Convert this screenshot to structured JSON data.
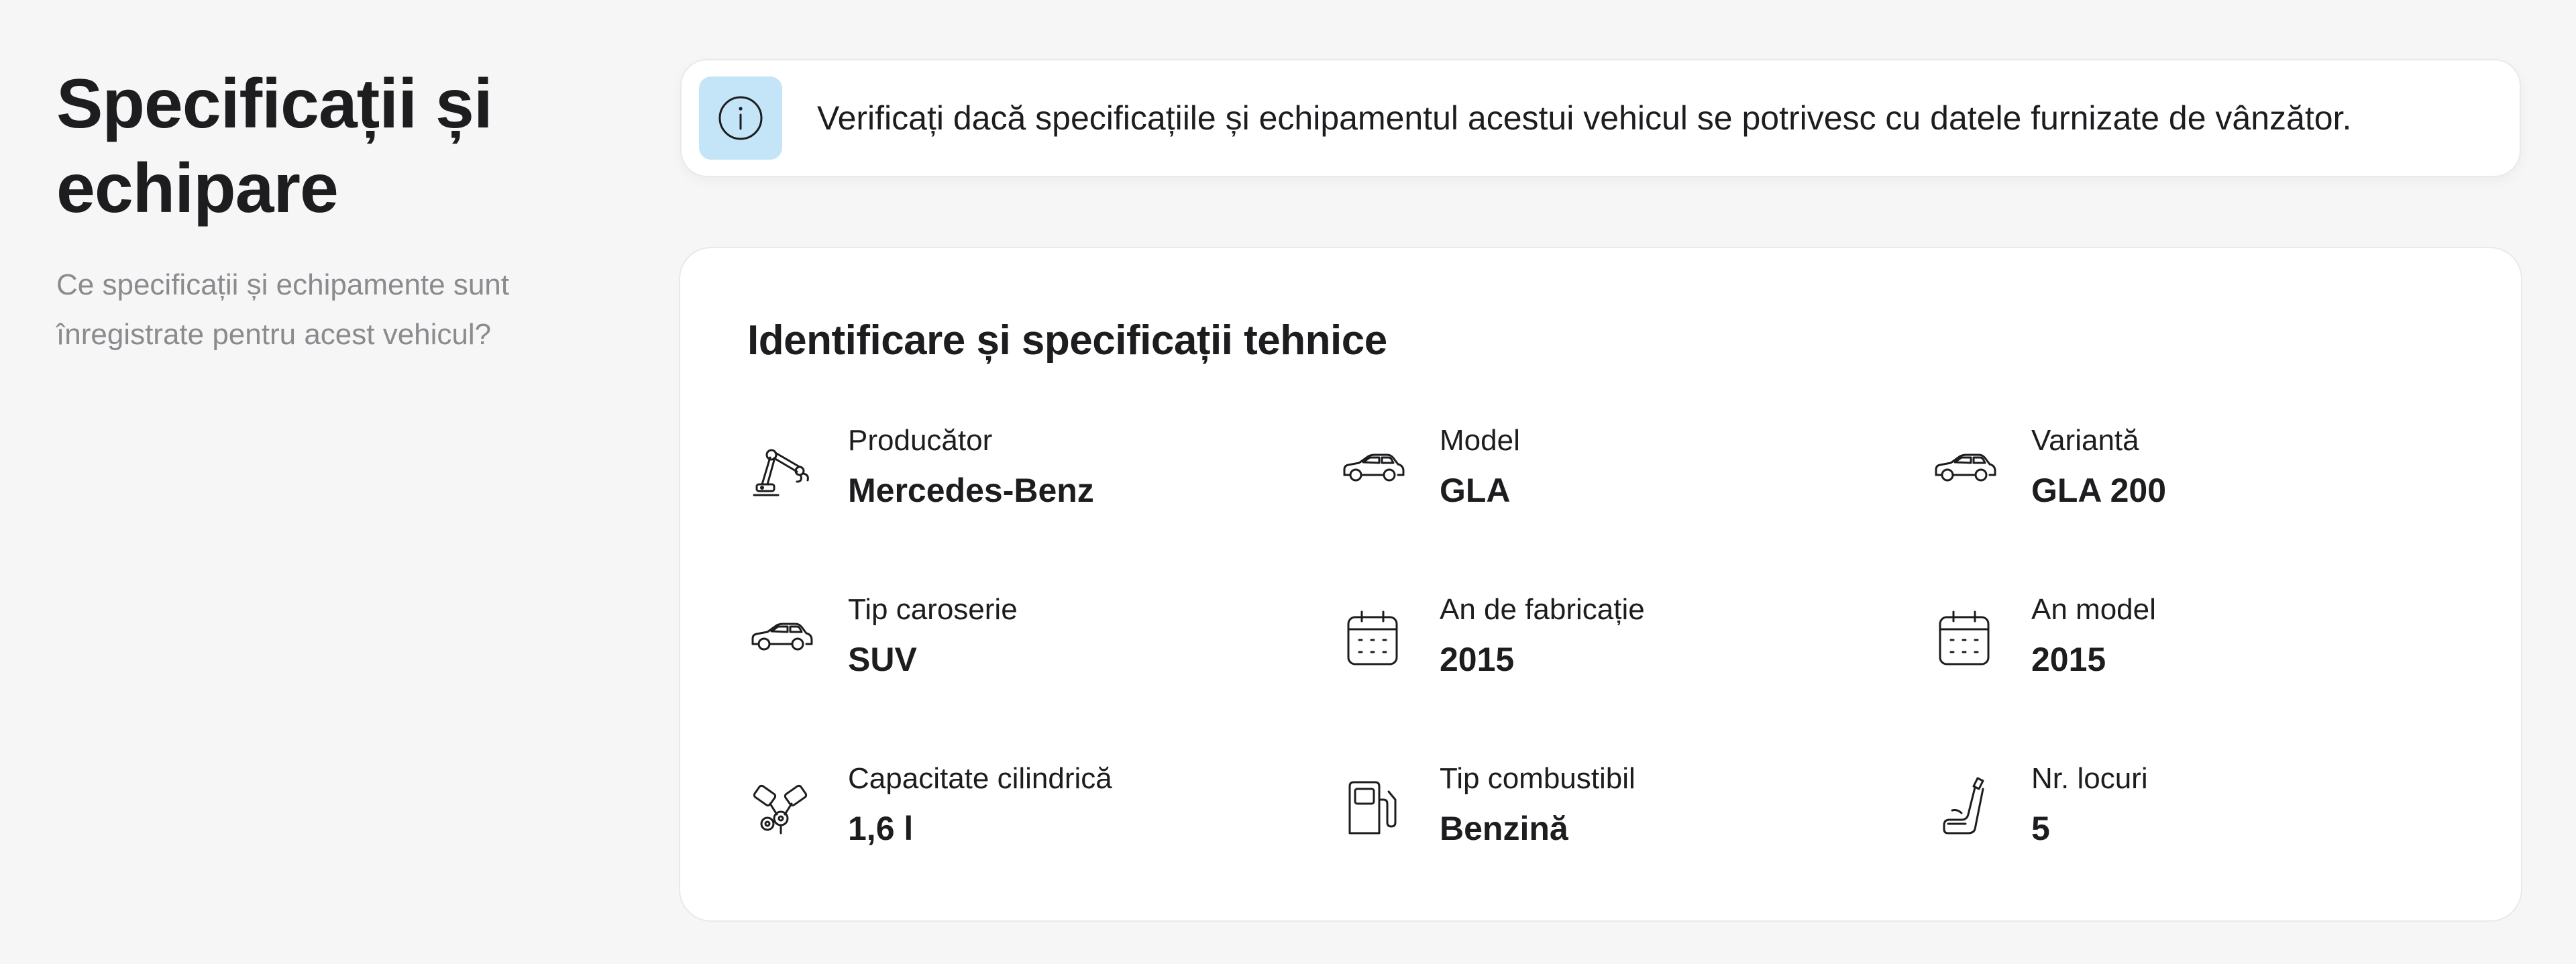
{
  "section": {
    "title": "Specificații și echipare",
    "subtitle": "Ce specificații și echipamente sunt înregistrate pentru acest vehicul?"
  },
  "banner": {
    "icon": "info-icon",
    "text": "Verificați dacă specificațiile și echipamentul acestui vehicul se potrivesc cu datele furnizate de vânzător.",
    "icon_bg_color": "#c4e4f7"
  },
  "card": {
    "title": "Identificare și specificații tehnice",
    "items": [
      {
        "icon": "robot-arm-icon",
        "label": "Producător",
        "value": "Mercedes-Benz"
      },
      {
        "icon": "car-icon",
        "label": "Model",
        "value": "GLA"
      },
      {
        "icon": "car-icon",
        "label": "Variantă",
        "value": "GLA 200"
      },
      {
        "icon": "car-icon",
        "label": "Tip caroserie",
        "value": "SUV"
      },
      {
        "icon": "calendar-icon",
        "label": "An de fabricație",
        "value": "2015"
      },
      {
        "icon": "calendar-icon",
        "label": "An model",
        "value": "2015"
      },
      {
        "icon": "engine-icon",
        "label": "Capacitate cilindrică",
        "value": "1,6 l"
      },
      {
        "icon": "fuel-pump-icon",
        "label": "Tip combustibil",
        "value": "Benzină"
      },
      {
        "icon": "seat-icon",
        "label": "Nr. locuri",
        "value": "5"
      }
    ]
  }
}
